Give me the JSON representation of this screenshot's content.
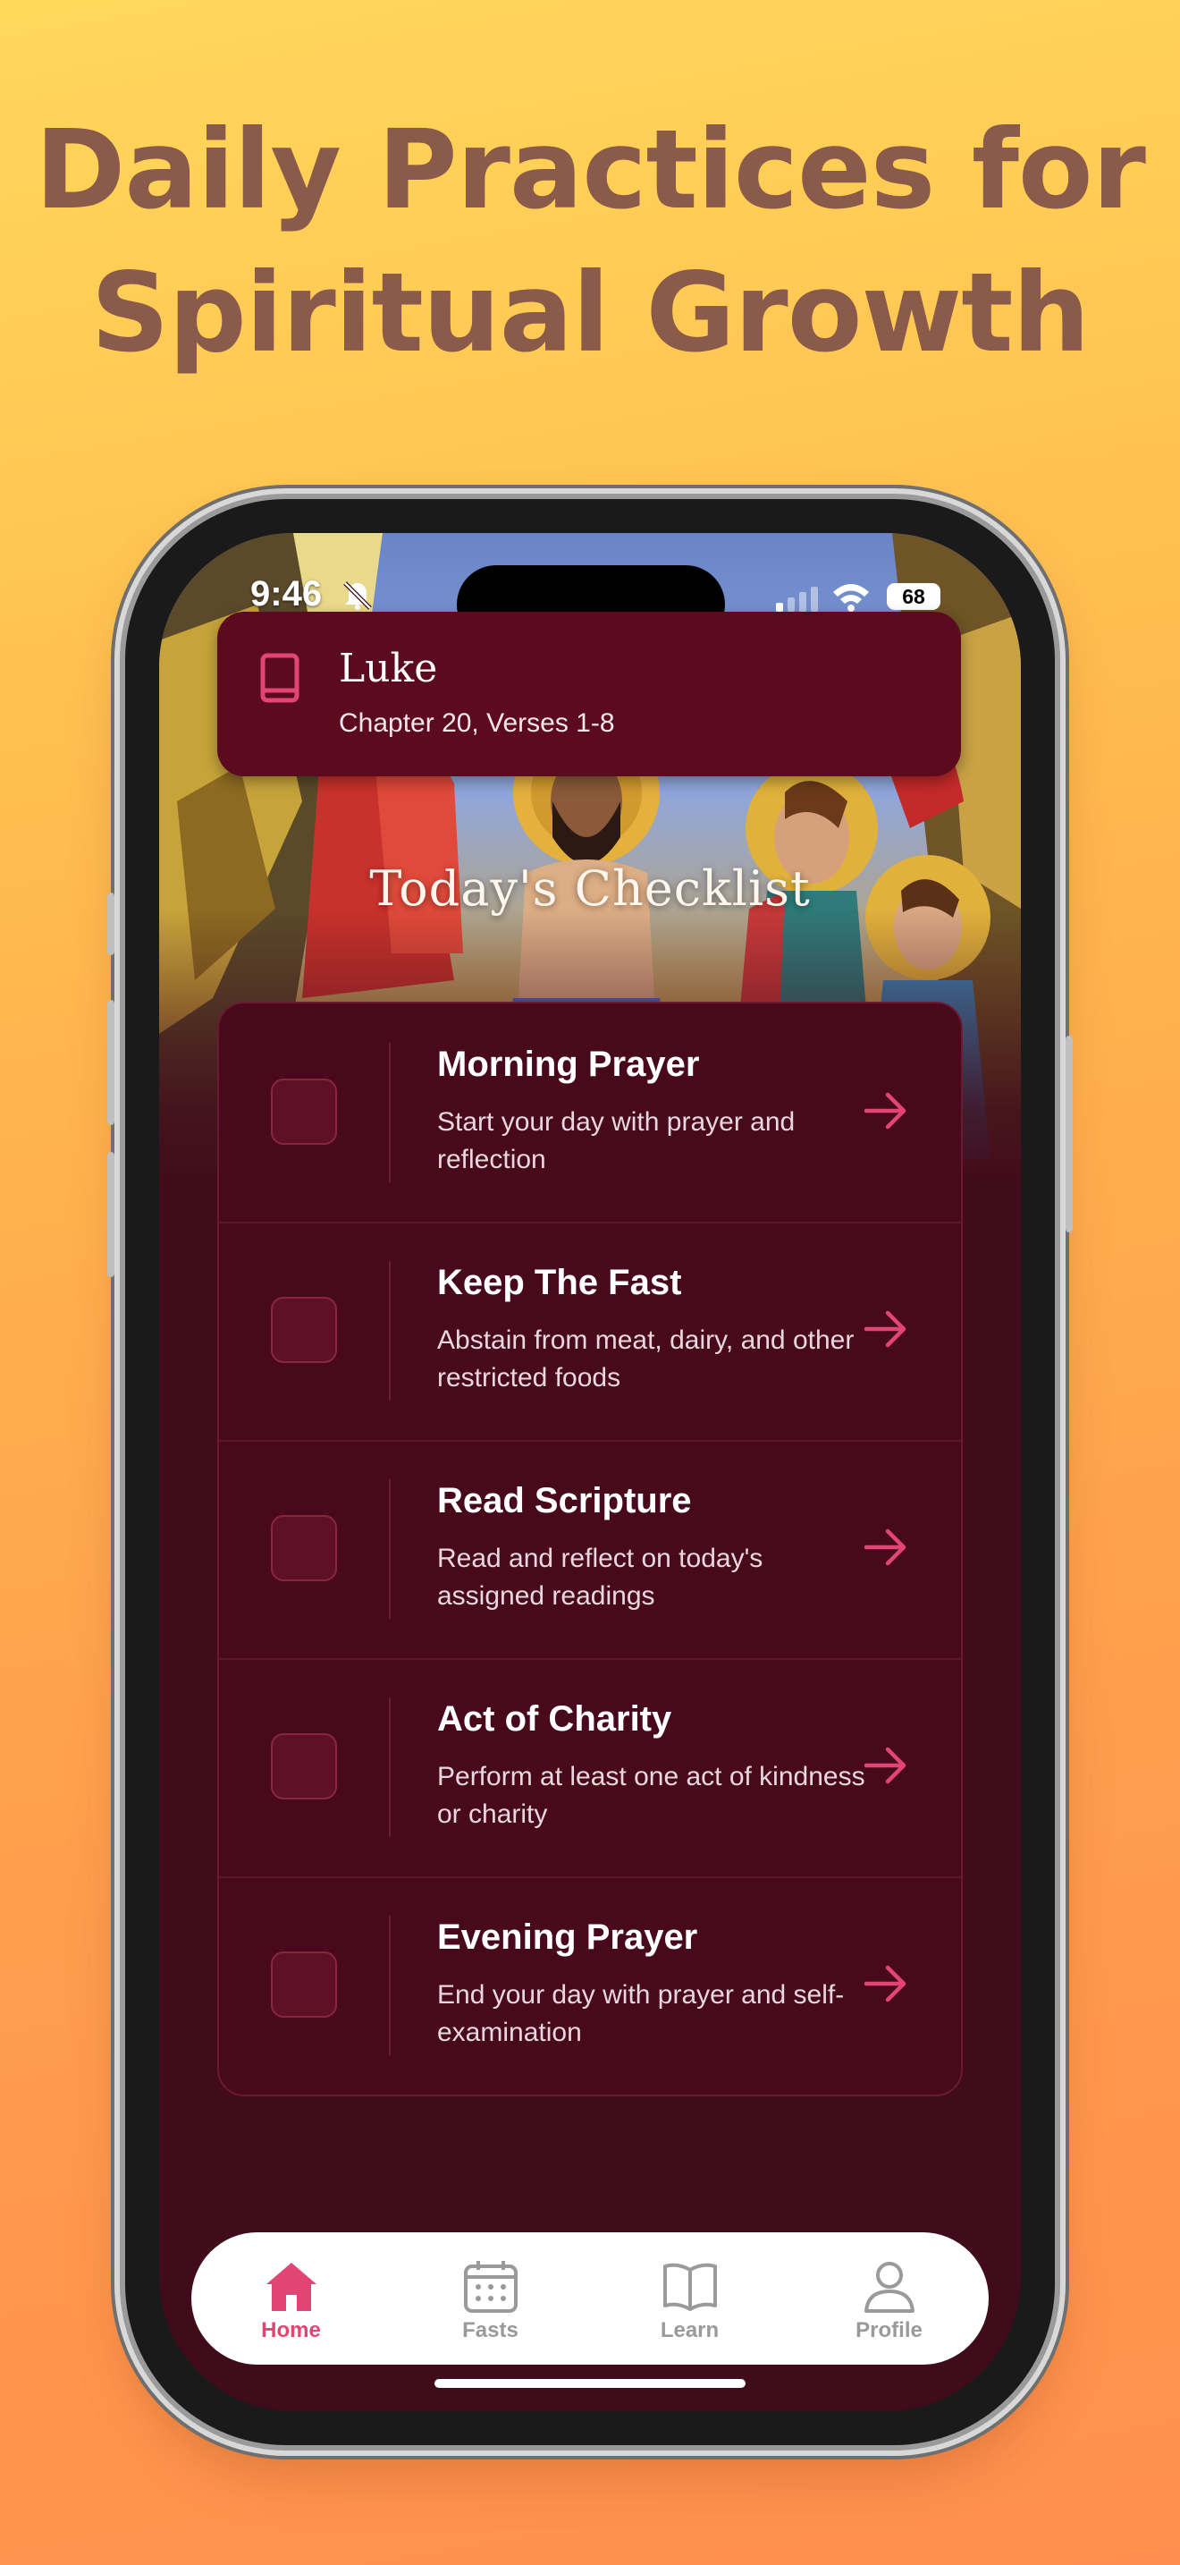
{
  "headline": {
    "line1": "Daily Practices for",
    "line2": "Spiritual Growth"
  },
  "status_bar": {
    "time": "9:46",
    "battery": "68"
  },
  "reading": {
    "book": "Luke",
    "reference": "Chapter 20, Verses 1-8"
  },
  "hero": {
    "title": "Today's Checklist"
  },
  "checklist": [
    {
      "title": "Morning Prayer",
      "description": "Start your day with prayer and reflection",
      "checked": false
    },
    {
      "title": "Keep The Fast",
      "description": "Abstain from meat, dairy, and other restricted foods",
      "checked": false
    },
    {
      "title": "Read Scripture",
      "description": "Read and reflect on today's assigned readings",
      "checked": false
    },
    {
      "title": "Act of Charity",
      "description": "Perform at least one act of kindness or charity",
      "checked": false
    },
    {
      "title": "Evening Prayer",
      "description": "End your day with prayer and self-examination",
      "checked": false
    }
  ],
  "tabs": [
    {
      "label": "Home",
      "icon": "home-icon",
      "active": true
    },
    {
      "label": "Fasts",
      "icon": "calendar-icon",
      "active": false
    },
    {
      "label": "Learn",
      "icon": "book-open-icon",
      "active": false
    },
    {
      "label": "Profile",
      "icon": "person-icon",
      "active": false
    }
  ],
  "colors": {
    "accent": "#e24574",
    "background": "#400b1a",
    "card": "#5c0a20"
  }
}
